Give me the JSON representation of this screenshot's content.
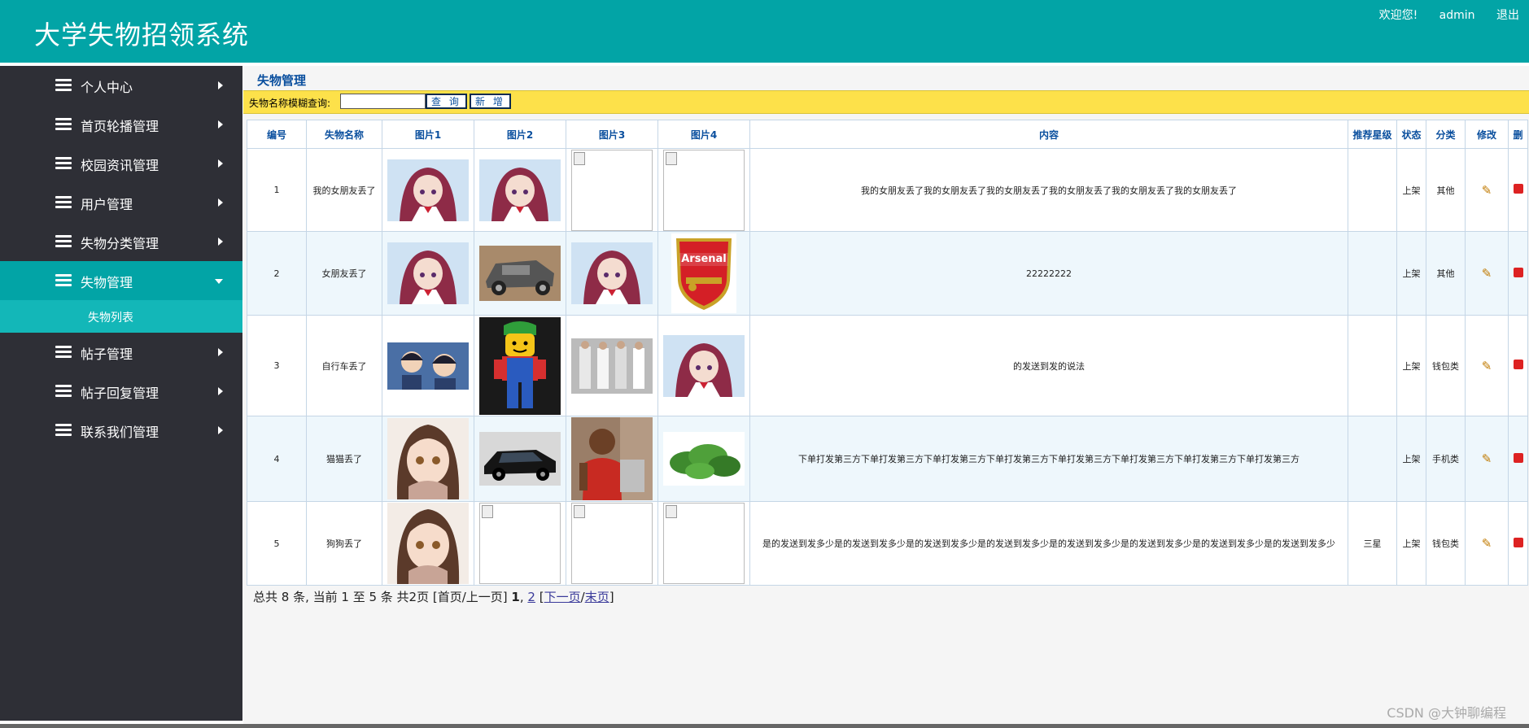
{
  "header": {
    "title": "大学失物招领系统",
    "welcome": "欢迎您!",
    "user": "admin",
    "logout": "退出"
  },
  "sidebar": {
    "items": [
      {
        "label": "个人中心"
      },
      {
        "label": "首页轮播管理"
      },
      {
        "label": "校园资讯管理"
      },
      {
        "label": "用户管理"
      },
      {
        "label": "失物分类管理"
      },
      {
        "label": "失物管理"
      },
      {
        "label": "帖子管理"
      },
      {
        "label": "帖子回复管理"
      },
      {
        "label": "联系我们管理"
      }
    ],
    "sub_items": [
      {
        "label": "失物列表"
      }
    ]
  },
  "main": {
    "heading": "失物管理",
    "search": {
      "label": "失物名称模糊查询:",
      "value": "",
      "query_button": "查 询",
      "add_button": "新 增"
    },
    "table": {
      "columns": [
        "编号",
        "失物名称",
        "图片1",
        "图片2",
        "图片3",
        "图片4",
        "内容",
        "推荐星级",
        "状态",
        "分类",
        "修改",
        "删"
      ],
      "rows": [
        {
          "id": "1",
          "name": "我的女朋友丢了",
          "img1": "anime-girl-red-hair",
          "img2": "anime-girl-red-hair",
          "img3": "broken-image",
          "img4": "broken-image",
          "content": "我的女朋友丢了我的女朋友丢了我的女朋友丢了我的女朋友丢了我的女朋友丢了我的女朋友丢了",
          "star": "",
          "status": "上架",
          "category": "其他"
        },
        {
          "id": "2",
          "name": "女朋友丢了",
          "img1": "anime-girl-red-hair",
          "img2": "lego-car",
          "img3": "anime-girl-red-hair",
          "img4": "arsenal-logo",
          "content": "22222222",
          "star": "",
          "status": "上架",
          "category": "其他"
        },
        {
          "id": "3",
          "name": "自行车丢了",
          "img1": "anime-two-boys",
          "img2": "lego-figure",
          "img3": "fashion-models",
          "img4": "anime-girl-red-hair",
          "content": "的发送到发的说法",
          "star": "",
          "status": "上架",
          "category": "钱包类"
        },
        {
          "id": "4",
          "name": "猫猫丢了",
          "img1": "anime-girl-brown-hair",
          "img2": "black-car",
          "img3": "man-red-shirt",
          "img4": "green-spinach",
          "content": "下单打发第三方下单打发第三方下单打发第三方下单打发第三方下单打发第三方下单打发第三方下单打发第三方下单打发第三方",
          "star": "",
          "status": "上架",
          "category": "手机类"
        },
        {
          "id": "5",
          "name": "狗狗丢了",
          "img1": "anime-girl-brown-hair",
          "img2": "broken-image",
          "img3": "broken-image",
          "img4": "broken-image",
          "content": "是的发送到发多少是的发送到发多少是的发送到发多少是的发送到发多少是的发送到发多少是的发送到发多少是的发送到发多少是的发送到发多少",
          "star": "三星",
          "status": "上架",
          "category": "钱包类"
        }
      ]
    },
    "pager": {
      "summary": "总共 8 条, 当前 1 至 5 条 共2页",
      "first_prev": "[首页/上一页]",
      "current": "1",
      "comma": ",",
      "page2": "2",
      "open": "[",
      "next": "下一页",
      "slash": "/",
      "last": "末页",
      "close": "]"
    }
  },
  "watermark": "CSDN @大钟聊编程",
  "colors": {
    "header": "#02a4a6",
    "sidebar": "#2e2f36",
    "active": "#02a4a6",
    "sub_active": "#13b7b8",
    "search_bar": "#fde14a"
  }
}
